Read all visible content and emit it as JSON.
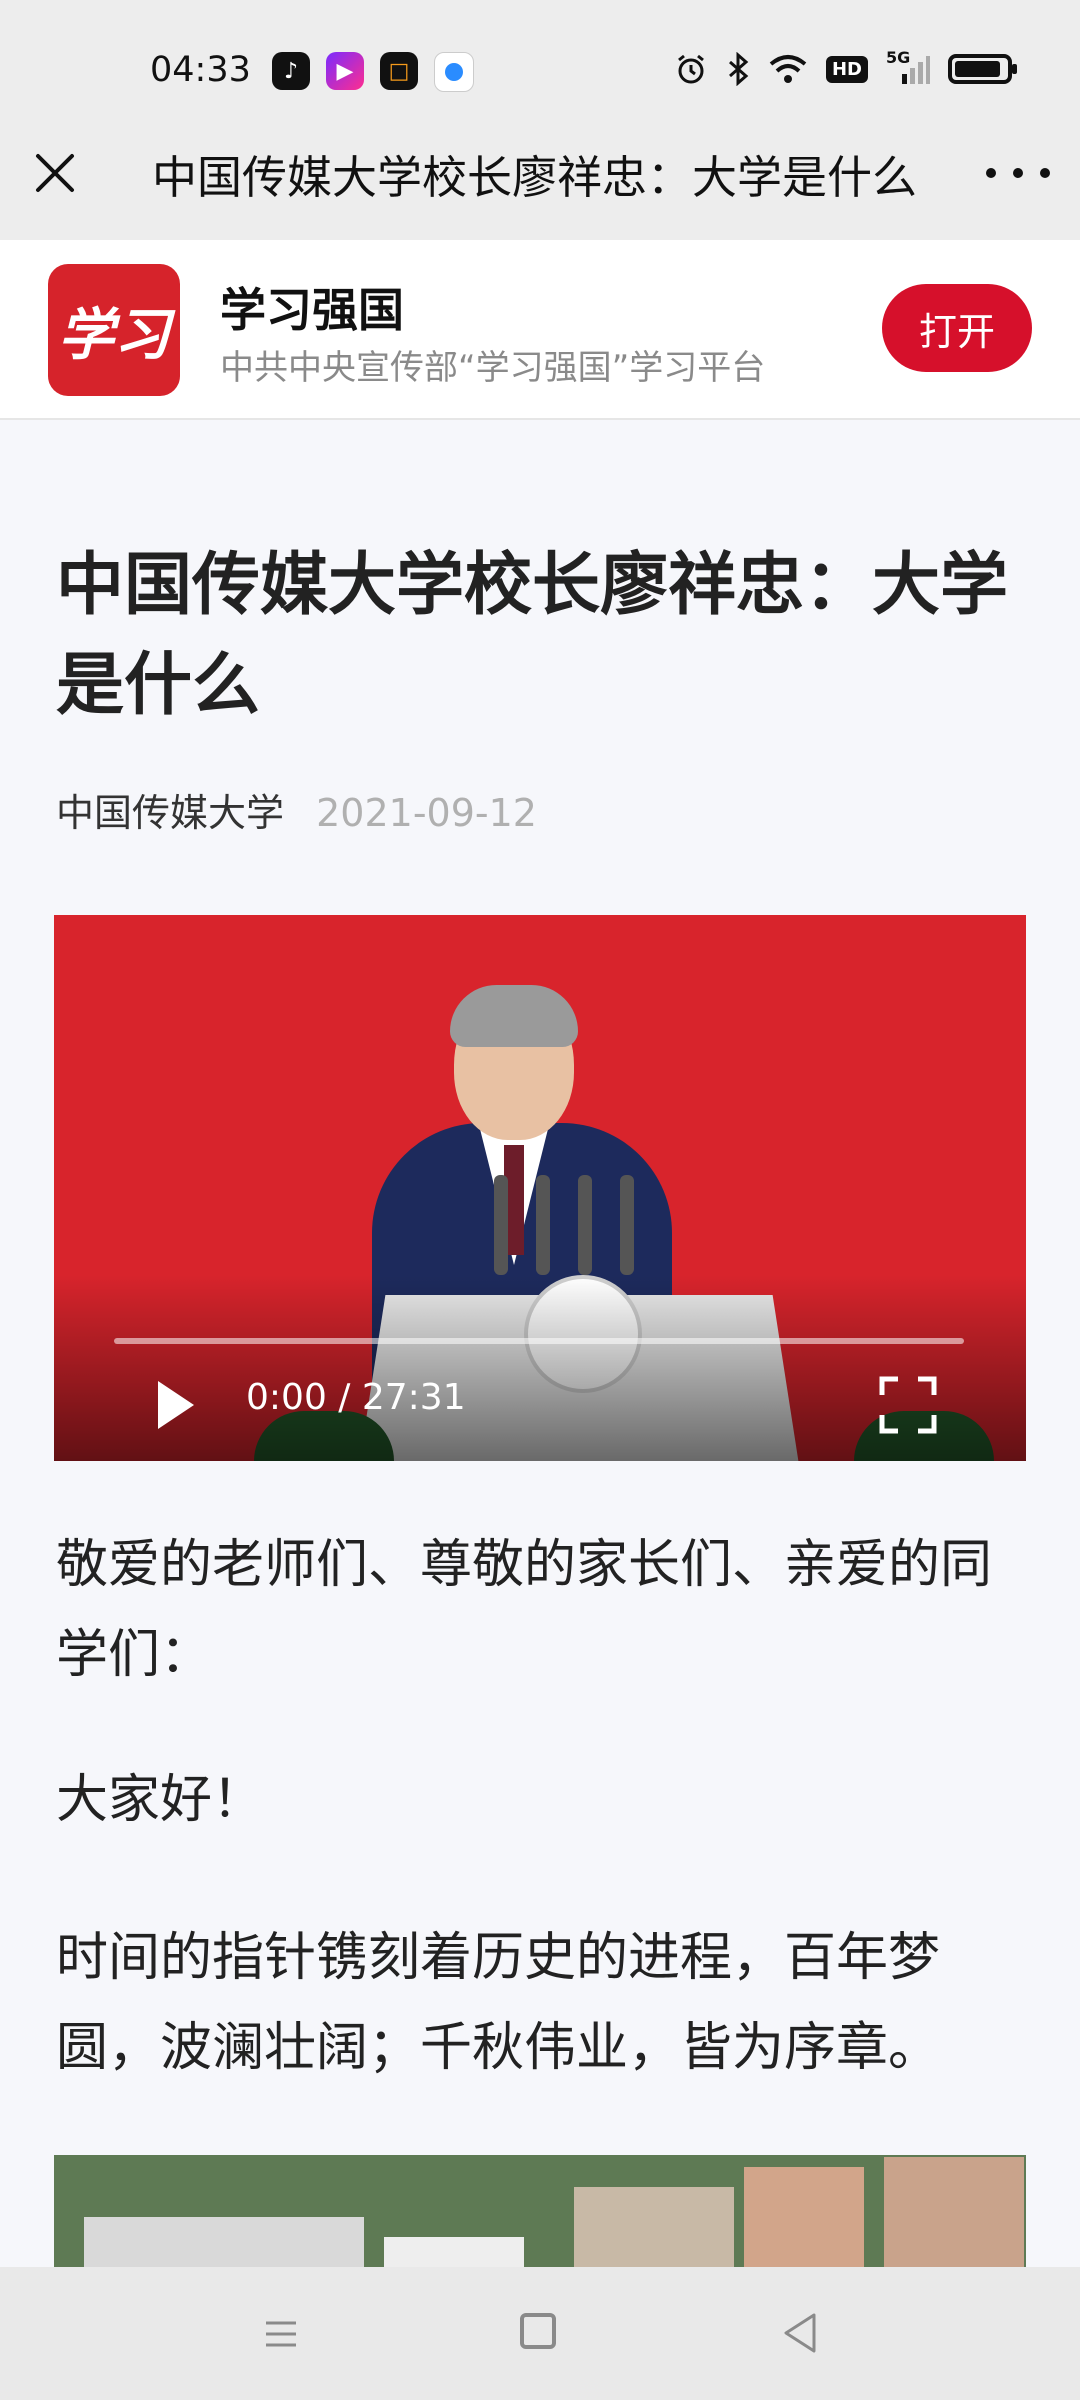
{
  "status_bar": {
    "time": "04:33",
    "app_icons": [
      "tiktok-icon",
      "video-app-icon",
      "orange-app-icon",
      "blue-dot-app-icon"
    ],
    "hd_label": "HD",
    "network_label": "5G",
    "icons": [
      "alarm-icon",
      "bluetooth-icon",
      "wifi-icon",
      "hd-icon",
      "signal-icon",
      "battery-icon"
    ],
    "battery_level": 0.9
  },
  "nav": {
    "title": "中国传媒大学校长廖祥忠：大学是什么"
  },
  "banner": {
    "logo_text": "学习",
    "app_name": "学习强国",
    "subtitle": "中共中央宣传部“学习强国”学习平台",
    "open_label": "打开"
  },
  "article": {
    "title": "中国传媒大学校长廖祥忠：大学是什么",
    "source": "中国传媒大学",
    "date": "2021-09-12",
    "video": {
      "time": "0:00 / 27:31",
      "progress": 0.0
    },
    "paragraphs": [
      "敬爱的老师们、尊敬的家长们、亲爱的同学们：",
      "大家好！",
      "时间的指针镌刻着历史的进程，百年梦圆，波澜壮阔；千秋伟业，皆为序章。"
    ]
  },
  "colors": {
    "accent_red": "#d6102b",
    "logo_red": "#d6232b",
    "background": "#f6f7fb",
    "bar_gray": "#ededed"
  }
}
